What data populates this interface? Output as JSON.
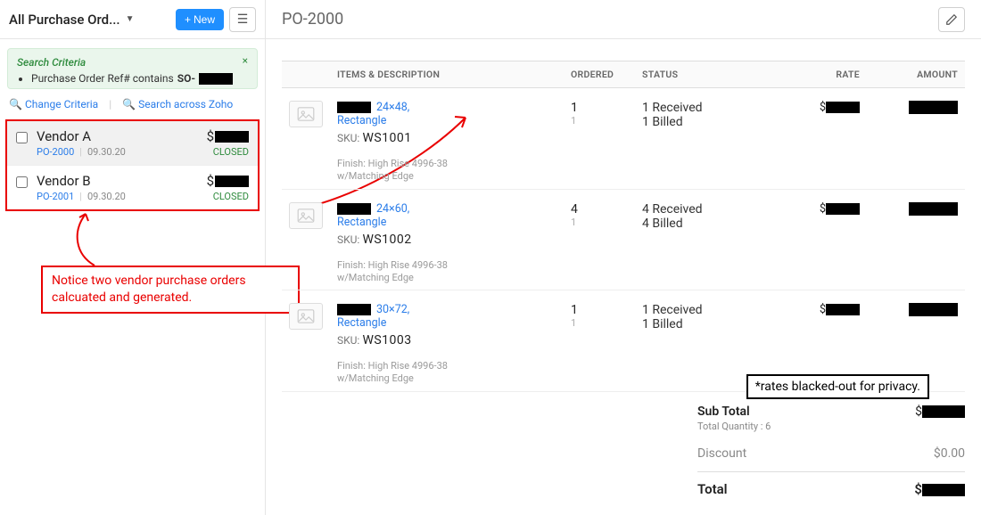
{
  "left": {
    "view_label": "All Purchase Ord...",
    "btn_new": "New",
    "search_criteria": {
      "title": "Search Criteria",
      "rule_prefix": "Purchase Order Ref# contains",
      "rule_value": "SO-",
      "change_link": "Change Criteria",
      "zoho_link": "Search across Zoho"
    },
    "rows": [
      {
        "vendor": "Vendor A",
        "po": "PO-2000",
        "date": "09.30.20",
        "status": "CLOSED"
      },
      {
        "vendor": "Vendor B",
        "po": "PO-2001",
        "date": "09.30.20",
        "status": "CLOSED"
      }
    ]
  },
  "right": {
    "title": "PO-2000",
    "columns": {
      "items": "Items & Description",
      "ordered": "Ordered",
      "status": "Status",
      "rate": "Rate",
      "amount": "Amount"
    },
    "items": [
      {
        "dims": "24×48,",
        "shape": "Rectangle",
        "sku_label": "SKU:",
        "sku": "WS1001",
        "finish": "Finish: High Rise 4996-38 w/Matching Edge",
        "ordered": "1",
        "ordered_sub": "1",
        "status_received": "1  Received",
        "status_billed": "1  Billed"
      },
      {
        "dims": "24×60,",
        "shape": "Rectangle",
        "sku_label": "SKU:",
        "sku": "WS1002",
        "finish": "Finish: High Rise 4996-38 w/Matching Edge",
        "ordered": "4",
        "ordered_sub": "1",
        "status_received": "4  Received",
        "status_billed": "4  Billed"
      },
      {
        "dims": "30×72,",
        "shape": "Rectangle",
        "sku_label": "SKU:",
        "sku": "WS1003",
        "finish": "Finish: High Rise 4996-38 w/Matching Edge",
        "ordered": "1",
        "ordered_sub": "1",
        "status_received": "1  Received",
        "status_billed": "1  Billed"
      }
    ],
    "totals": {
      "sub_label": "Sub Total",
      "qty_label": "Total Quantity : 6",
      "discount_label": "Discount",
      "discount_value": "$0.00",
      "total_label": "Total"
    }
  },
  "annotations": {
    "callout": "Notice two vendor purchase orders calcuated and generated.",
    "privacy": "*rates blacked-out for privacy."
  }
}
